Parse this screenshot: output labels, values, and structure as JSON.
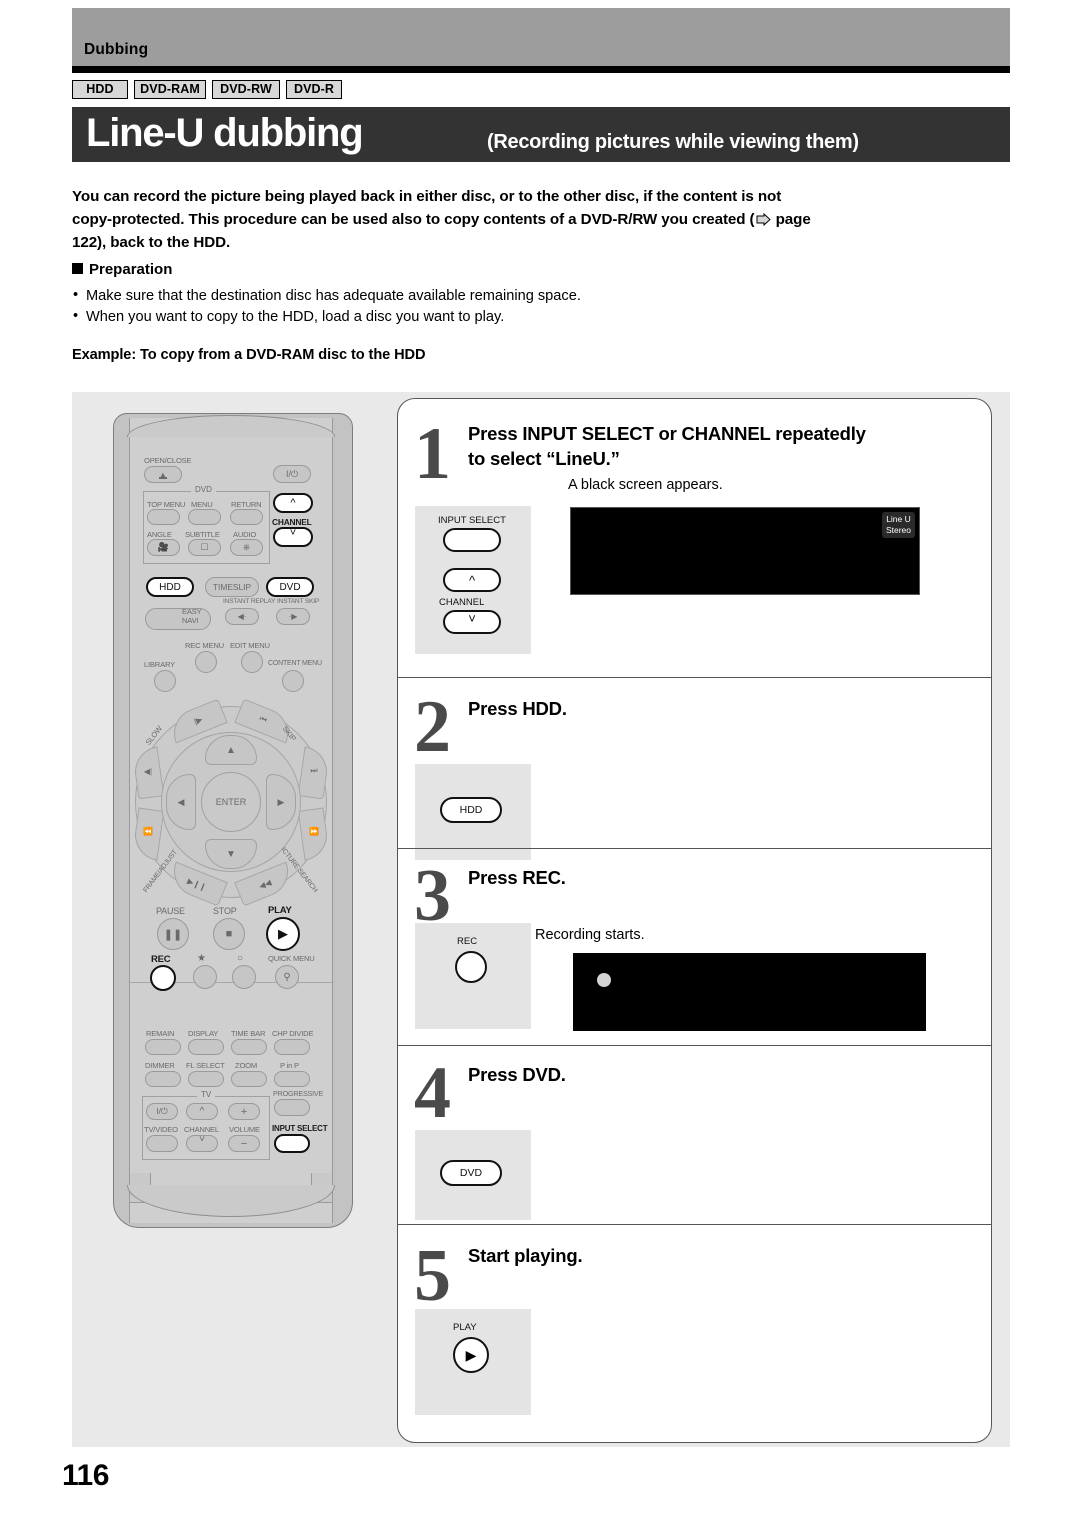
{
  "header": {
    "section_label": "Dubbing",
    "disc_tags": [
      "HDD",
      "DVD-RAM",
      "DVD-RW",
      "DVD-R"
    ],
    "title_main": "Line-U dubbing",
    "title_sub": "(Recording pictures while viewing them)"
  },
  "intro": {
    "line1": "You can record the picture being played back in either disc, or to the other disc, if the content is not",
    "line2a": "copy-protected. This procedure can be used also to copy contents of a DVD-R/RW you created (",
    "line2b": " page",
    "line3": "122), back to the HDD.",
    "preparation_heading": "Preparation",
    "bullets": [
      "Make sure that the destination disc has adequate available remaining space.",
      "When you want to copy to the HDD, load a disc you want to play."
    ],
    "example": "Example: To copy from a DVD-RAM disc to the HDD"
  },
  "remote": {
    "labels": {
      "open_close": "OPEN/CLOSE",
      "power": "I/⏻",
      "dvd_group": "DVD",
      "top_menu": "TOP MENU",
      "menu": "MENU",
      "return": "RETURN",
      "angle": "ANGLE",
      "subtitle": "SUBTITLE",
      "audio": "AUDIO",
      "channel": "CHANNEL",
      "hdd": "HDD",
      "timeslip": "TIMESLIP",
      "dvd": "DVD",
      "easy_navi": "EASY\nNAVI",
      "instant_replay": "INSTANT REPLAY",
      "instant_skip": "INSTANT SKIP",
      "rec_menu": "REC MENU",
      "edit_menu": "EDIT MENU",
      "library": "LIBRARY",
      "content_menu": "CONTENT MENU",
      "slow": "SLOW",
      "skip": "SKIP",
      "frame_adjust": "FRAME/ADJUST",
      "picture_search": "PICTURE SEARCH",
      "enter": "ENTER",
      "pause": "PAUSE",
      "stop": "STOP",
      "play": "PLAY",
      "rec": "REC",
      "quick_menu": "QUICK MENU",
      "remain": "REMAIN",
      "display": "DISPLAY",
      "time_bar": "TIME BAR",
      "chp_divide": "CHP DIVIDE",
      "dimmer": "DIMMER",
      "fl_select": "FL SELECT",
      "zoom": "ZOOM",
      "p_in_p": "P in P",
      "tv_group": "TV",
      "progressive": "PROGRESSIVE",
      "tv_video": "TV/VIDEO",
      "tv_channel": "CHANNEL",
      "volume": "VOLUME",
      "input_select": "INPUT SELECT"
    }
  },
  "steps": [
    {
      "number": "1",
      "title_line1": "Press INPUT SELECT or CHANNEL repeatedly",
      "title_line2": "to select “LineU.”",
      "note": "A black screen appears.",
      "key_top_label": "INPUT SELECT",
      "key_bottom_label": "CHANNEL",
      "osd_line1": "Line U",
      "osd_line2": "Stereo"
    },
    {
      "number": "2",
      "title_line1": "Press HDD.",
      "key_label": "HDD"
    },
    {
      "number": "3",
      "title_line1": "Press REC.",
      "note": "Recording starts.",
      "key_label": "REC"
    },
    {
      "number": "4",
      "title_line1": "Press DVD.",
      "key_label": "DVD"
    },
    {
      "number": "5",
      "title_line1": "Start playing.",
      "key_label": "PLAY"
    }
  ],
  "footer": {
    "page_number": "116"
  },
  "colors": {
    "header_band": "#9d9d9d",
    "title_bar": "#333333",
    "panel_bg": "#e9e9e9",
    "key_box": "#e4e4e4",
    "step_number": "#4a4a4a"
  }
}
